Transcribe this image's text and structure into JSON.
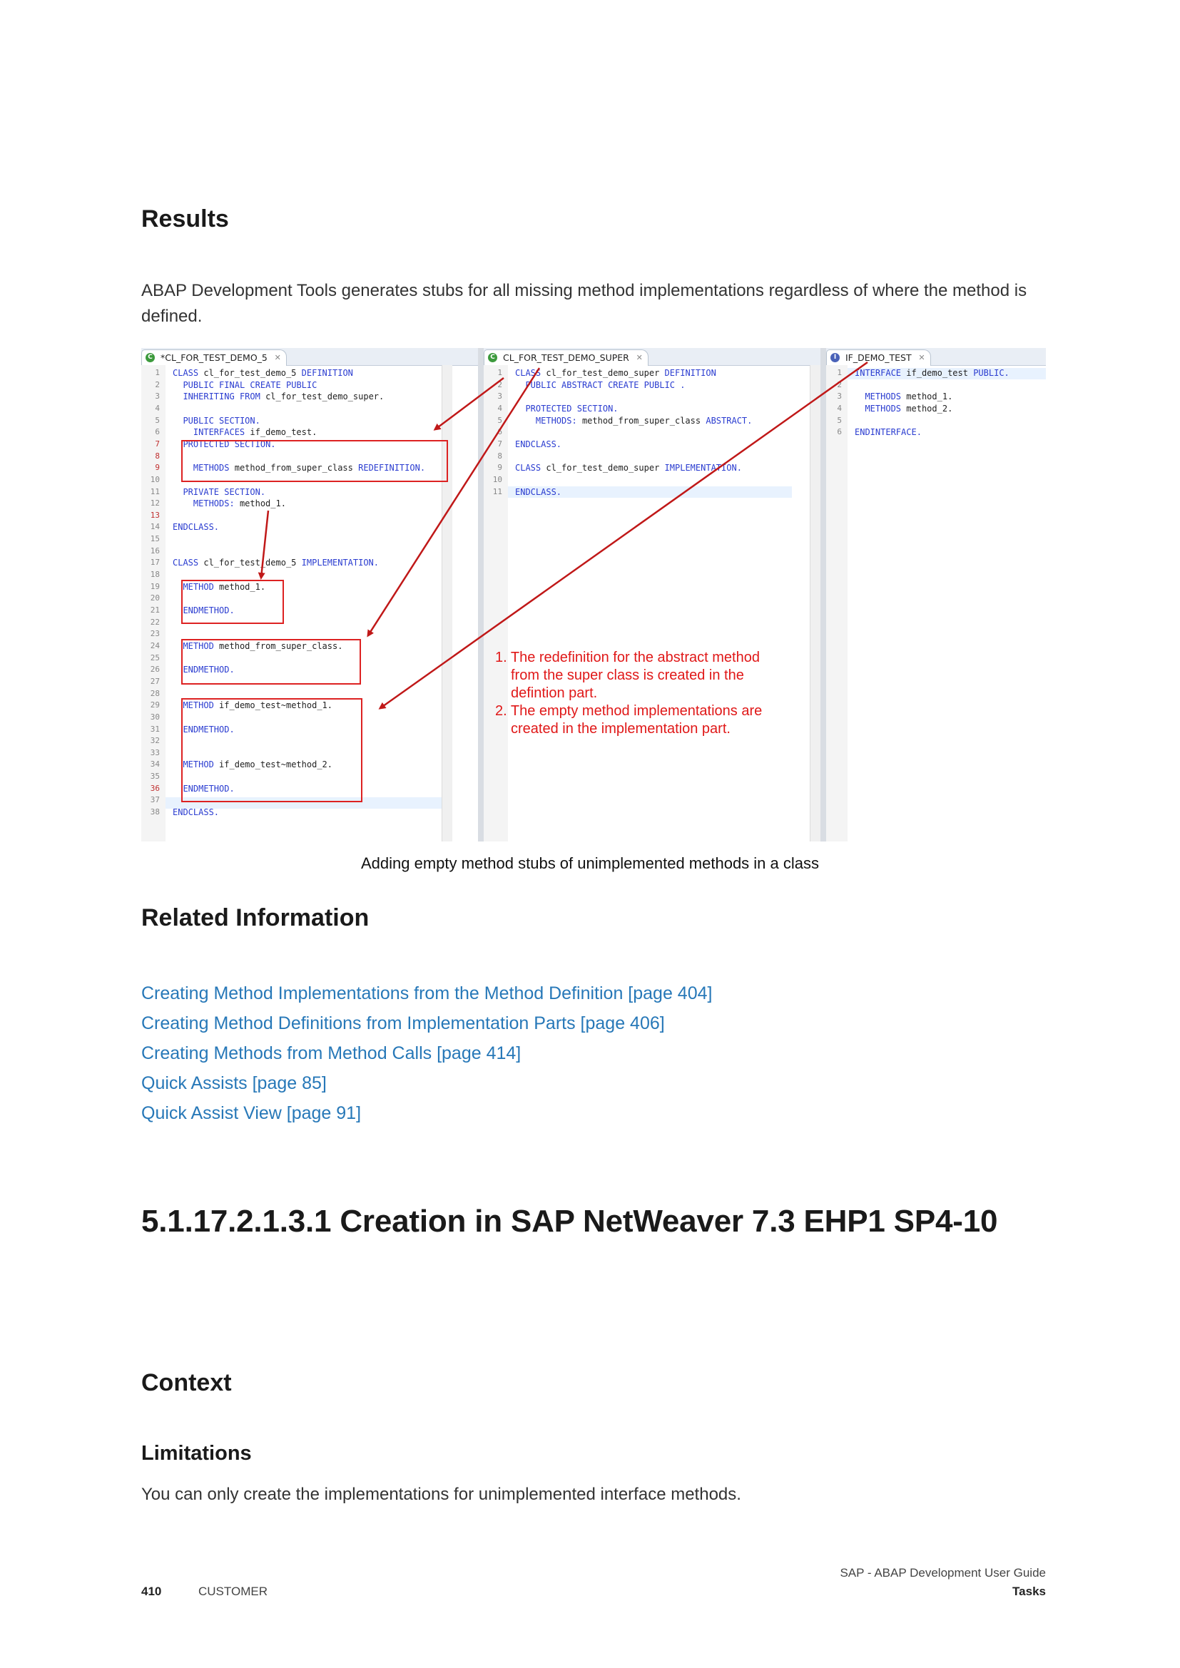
{
  "results": {
    "heading": "Results",
    "text": "ABAP Development Tools generates stubs for all missing method implementations regardless of where the method is defined."
  },
  "figure": {
    "tabs": {
      "left": "*CL_FOR_TEST_DEMO_5",
      "middle": "CL_FOR_TEST_DEMO_SUPER",
      "right": "IF_DEMO_TEST"
    },
    "icons": {
      "class_icon": "class-icon",
      "interface_icon": "interface-icon",
      "close_icon": "close-icon"
    },
    "left_code": [
      {
        "n": "1",
        "t": "CLASS cl_for_test_demo_5 DEFINITION"
      },
      {
        "n": "2",
        "t": "  PUBLIC FINAL CREATE PUBLIC"
      },
      {
        "n": "3",
        "t": "  INHERITING FROM cl_for_test_demo_super."
      },
      {
        "n": "4",
        "t": ""
      },
      {
        "n": "5",
        "t": "  PUBLIC SECTION."
      },
      {
        "n": "6",
        "t": "    INTERFACES if_demo_test."
      },
      {
        "n": "7",
        "t": "  PROTECTED SECTION."
      },
      {
        "n": "8",
        "t": ""
      },
      {
        "n": "9",
        "t": "    METHODS method_from_super_class REDEFINITION."
      },
      {
        "n": "10",
        "t": ""
      },
      {
        "n": "11",
        "t": "  PRIVATE SECTION."
      },
      {
        "n": "12",
        "t": "    METHODS: method_1."
      },
      {
        "n": "13",
        "t": ""
      },
      {
        "n": "14",
        "t": "ENDCLASS."
      },
      {
        "n": "15",
        "t": ""
      },
      {
        "n": "16",
        "t": ""
      },
      {
        "n": "17",
        "t": "CLASS cl_for_test_demo_5 IMPLEMENTATION."
      },
      {
        "n": "18",
        "t": ""
      },
      {
        "n": "19",
        "t": "  METHOD method_1."
      },
      {
        "n": "20",
        "t": ""
      },
      {
        "n": "21",
        "t": "  ENDMETHOD."
      },
      {
        "n": "22",
        "t": ""
      },
      {
        "n": "23",
        "t": ""
      },
      {
        "n": "24",
        "t": "  METHOD method_from_super_class."
      },
      {
        "n": "25",
        "t": ""
      },
      {
        "n": "26",
        "t": "  ENDMETHOD."
      },
      {
        "n": "27",
        "t": ""
      },
      {
        "n": "28",
        "t": ""
      },
      {
        "n": "29",
        "t": "  METHOD if_demo_test~method_1."
      },
      {
        "n": "30",
        "t": ""
      },
      {
        "n": "31",
        "t": "  ENDMETHOD."
      },
      {
        "n": "32",
        "t": ""
      },
      {
        "n": "33",
        "t": ""
      },
      {
        "n": "34",
        "t": "  METHOD if_demo_test~method_2."
      },
      {
        "n": "35",
        "t": ""
      },
      {
        "n": "36",
        "t": "  ENDMETHOD."
      },
      {
        "n": "37",
        "t": ""
      },
      {
        "n": "38",
        "t": "ENDCLASS."
      }
    ],
    "middle_code": [
      {
        "n": "1",
        "t": "CLASS cl_for_test_demo_super DEFINITION"
      },
      {
        "n": "2",
        "t": "  PUBLIC ABSTRACT CREATE PUBLIC ."
      },
      {
        "n": "3",
        "t": ""
      },
      {
        "n": "4",
        "t": "  PROTECTED SECTION."
      },
      {
        "n": "5",
        "t": "    METHODS: method_from_super_class ABSTRACT."
      },
      {
        "n": "6",
        "t": ""
      },
      {
        "n": "7",
        "t": "ENDCLASS."
      },
      {
        "n": "8",
        "t": ""
      },
      {
        "n": "9",
        "t": "CLASS cl_for_test_demo_super IMPLEMENTATION."
      },
      {
        "n": "10",
        "t": ""
      },
      {
        "n": "11",
        "t": "ENDCLASS."
      }
    ],
    "right_code": [
      {
        "n": "1",
        "t": "INTERFACE if_demo_test PUBLIC."
      },
      {
        "n": "2",
        "t": ""
      },
      {
        "n": "3",
        "t": "  METHODS method_1."
      },
      {
        "n": "4",
        "t": "  METHODS method_2."
      },
      {
        "n": "5",
        "t": ""
      },
      {
        "n": "6",
        "t": "ENDINTERFACE."
      }
    ],
    "annotation": {
      "line1": "1. The redefinition for the abstract method",
      "line2": "from the super class is created in the",
      "line3": "defintion part.",
      "line4": "2. The empty method implementations are",
      "line5": "created in the implementation part."
    },
    "accent_red": "#d22222",
    "keyword_blue": "#2a3cd0"
  },
  "caption": "Adding empty method stubs of unimplemented methods in a class",
  "related": {
    "heading": "Related Information",
    "links": [
      "Creating Method Implementations from the Method Definition [page 404]",
      "Creating Method Definitions from Implementation Parts [page 406]",
      "Creating Methods from Method Calls [page 414]",
      "Quick Assists [page 85]",
      "Quick Assist View [page 91]"
    ],
    "link_color": "#2778b8"
  },
  "section": {
    "title": "5.1.17.2.1.3.1  Creation in SAP NetWeaver 7.3 EHP1 SP4-10",
    "context_heading": "Context",
    "limitations_heading": "Limitations",
    "limitations_text": "You can only create the implementations for unimplemented interface methods."
  },
  "footer": {
    "page_number": "410",
    "label": "CUSTOMER",
    "doc_title": "SAP - ABAP Development User Guide",
    "chapter": "Tasks"
  }
}
